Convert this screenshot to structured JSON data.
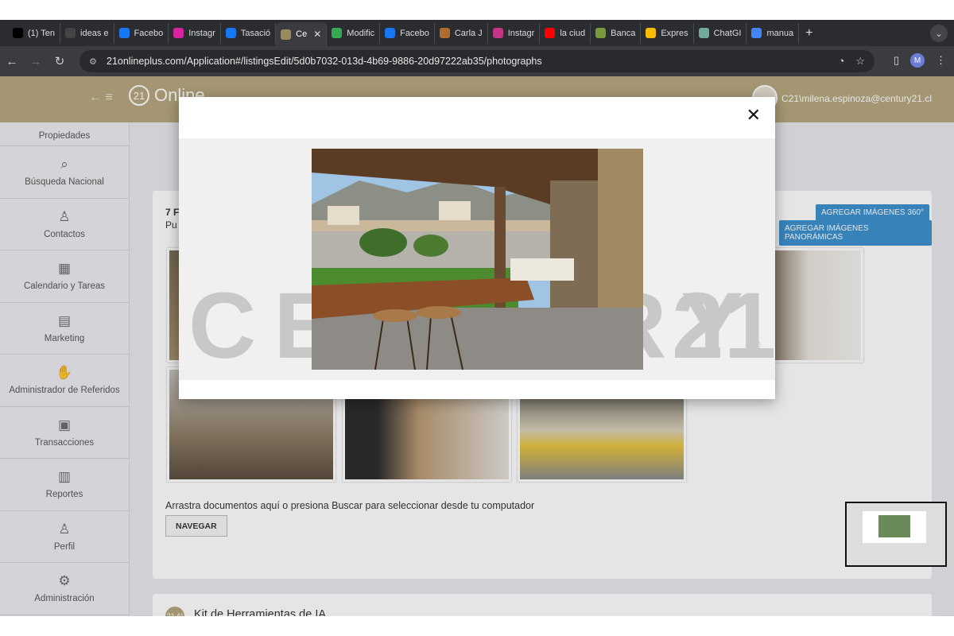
{
  "browser": {
    "tabs": [
      {
        "label": "(1) Ten",
        "icon": "x-icon",
        "color": "#000000"
      },
      {
        "label": "ideas e",
        "icon": "openai-icon",
        "color": "#444444"
      },
      {
        "label": "Facebo",
        "icon": "facebook-icon",
        "color": "#1877f2"
      },
      {
        "label": "Instagr",
        "icon": "instagram-icon",
        "color": "#d6249f"
      },
      {
        "label": "Tasació",
        "icon": "pinterest-icon",
        "color": "#1877f2"
      },
      {
        "label": "Ce",
        "icon": "century21-icon",
        "color": "#9a8a5e",
        "active": true
      },
      {
        "label": "Modific",
        "icon": "maps-pin-icon",
        "color": "#34a853"
      },
      {
        "label": "Facebo",
        "icon": "facebook-icon",
        "color": "#1877f2"
      },
      {
        "label": "Carla J",
        "icon": "openai-icon",
        "color": "#b06b2e"
      },
      {
        "label": "Instagr",
        "icon": "instagram-icon",
        "color": "#c13584"
      },
      {
        "label": "la ciud",
        "icon": "youtube-icon",
        "color": "#ff0000"
      },
      {
        "label": "Banca",
        "icon": "openai-icon",
        "color": "#7a9a3a"
      },
      {
        "label": "Expres",
        "icon": "maps-pin-icon",
        "color": "#fbbc05"
      },
      {
        "label": "ChatGI",
        "icon": "chatgpt-icon",
        "color": "#74aa9c"
      },
      {
        "label": "manua",
        "icon": "google-icon",
        "color": "#4285f4"
      }
    ],
    "url": "21onlineplus.com/Application#/listingsEdit/5d0b7032-013d-4b69-9886-20d97222ab35/photographs",
    "profile_initial": "M"
  },
  "header": {
    "logo_mark": "21",
    "logo_text": "Online",
    "user_email": "C21\\milena.espinoza@century21.cl"
  },
  "sidebar": {
    "items": [
      {
        "label": "Propiedades",
        "icon": "house-icon"
      },
      {
        "label": "Búsqueda Nacional",
        "icon": "search-icon"
      },
      {
        "label": "Contactos",
        "icon": "contacts-icon"
      },
      {
        "label": "Calendario y Tareas",
        "icon": "calendar-icon"
      },
      {
        "label": "Marketing",
        "icon": "book-icon"
      },
      {
        "label": "Administrador de Referidos",
        "icon": "handshake-icon"
      },
      {
        "label": "Transacciones",
        "icon": "briefcase-icon"
      },
      {
        "label": "Reportes",
        "icon": "bar-chart-icon"
      },
      {
        "label": "Perfil",
        "icon": "user-icon"
      },
      {
        "label": "Administración",
        "icon": "gear-icon"
      }
    ]
  },
  "main": {
    "card_title": "7 F",
    "card_subtitle": "Pu",
    "btn_360": "AGREGAR IMÁGENES 360°",
    "btn_panoramic": "AGREGAR IMÁGENES PANORÁMICAS",
    "drop_text": "Arrastra documentos aquí o presiona Buscar para seleccionar desde tu computador",
    "navegar": "NAVEGAR",
    "kit_title": "Kit de Herramientas de IA.",
    "kit_icon_text": "21 AI"
  },
  "modal": {
    "close_symbol": "✕",
    "watermark_text": "CENTURY",
    "watermark_num": "21",
    "watermark_reg": "®"
  }
}
